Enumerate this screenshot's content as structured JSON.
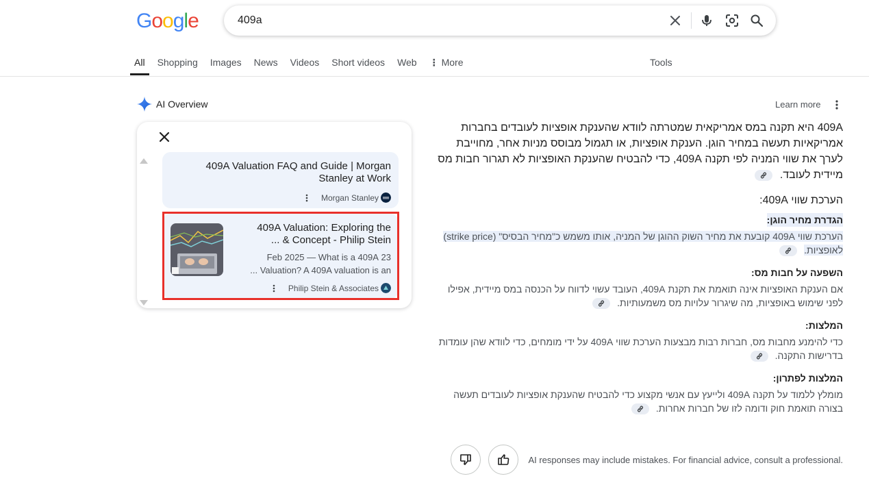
{
  "logo": {
    "text": "Google",
    "letters": [
      "G",
      "o",
      "o",
      "g",
      "l",
      "e"
    ]
  },
  "search": {
    "query": "409a",
    "placeholder": ""
  },
  "tabs": [
    {
      "label": "All",
      "active": true
    },
    {
      "label": "Shopping"
    },
    {
      "label": "Images"
    },
    {
      "label": "News"
    },
    {
      "label": "Videos"
    },
    {
      "label": "Short videos"
    },
    {
      "label": "Web"
    },
    {
      "label": "More"
    }
  ],
  "tools_label": "Tools",
  "ai_overview": {
    "title": "AI Overview",
    "learn_more": "Learn more"
  },
  "sources": [
    {
      "title": "409A Valuation FAQ and Guide | Morgan Stanley at Work",
      "source": "Morgan Stanley"
    },
    {
      "title": "409A Valuation: Exploring the Concept - Philip Stein & ...",
      "snippet": "23 Feb 2025 — What is a 409A Valuation? A 409A valuation is an ...",
      "source": "Philip Stein & Associates"
    }
  ],
  "answer": {
    "intro": "409A היא תקנה במס אמריקאית שמטרתה לוודא שהענקת אופציות לעובדים בחברות אמריקאיות תעשה במחיר הוגן. הענקת אופציות, או תגמול מבוסס מניות אחר, מחוייבת לערך את שווי המניה לפי תקנה 409A, כדי להבטיח שהענקת האופציות לא תגרור חבות מס מיידית לעובד.",
    "subheading": "הערכת שווי 409A:",
    "sections": [
      {
        "title": "הגדרת מחיר הוגן:",
        "body": "הערכת שווי 409A קובעת את מחיר השוק ההוגן של המניה, אותו משמש כ\"מחיר הבסיס\" (strike price) לאופציות."
      },
      {
        "title": "השפעה על חבות מס:",
        "body": "אם הענקת האופציות אינה תואמת את תקנת 409A, העובד עשוי לדווח על הכנסה במס מיידית, אפילו לפני שימוש באופציות, מה שיגרור עלויות מס משמעותיות."
      },
      {
        "title": "המלצות:",
        "body": "כדי להימנע מחבות מס, חברות רבות מבצעות הערכת שווי 409A על ידי מומחים, כדי לוודא שהן עומדות בדרישות התקנה."
      },
      {
        "title": "המלצות לפתרון:",
        "body": "מומלץ ללמוד על תקנה 409A ולייעץ עם אנשי מקצוע כדי להבטיח שהענקת אופציות לעובדים תעשה בצורה תואמת חוק ודומה לזו של חברות אחרות."
      }
    ]
  },
  "footer": {
    "disclaimer": "AI responses may include mistakes. For financial advice, consult a professional."
  },
  "colors": {
    "accent": "#1a73e8",
    "highlight": "#e8eef9",
    "card_bg": "#eef3fb",
    "red_box": "#e8302a"
  }
}
